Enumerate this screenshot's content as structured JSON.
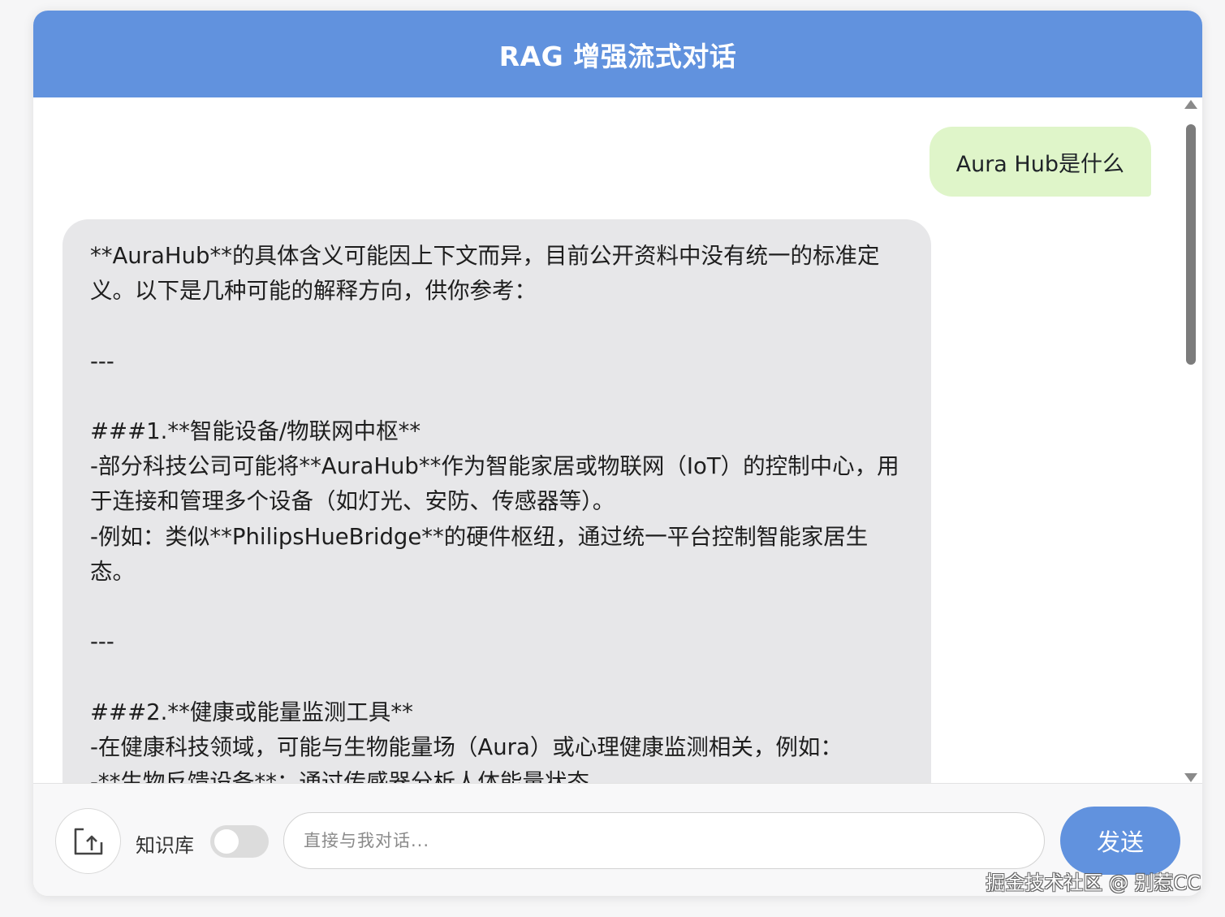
{
  "header": {
    "title": "RAG 增强流式对话"
  },
  "messages": {
    "user": "Aura Hub是什么",
    "assistant": "**AuraHub**的具体含义可能因上下文而异，目前公开资料中没有统一的标准定义。以下是几种可能的解释方向，供你参考：\n\n---\n\n###1.**智能设备/物联网中枢**\n-部分科技公司可能将**AuraHub**作为智能家居或物联网（IoT）的控制中心，用于连接和管理多个设备（如灯光、安防、传感器等）。\n-例如：类似**PhilipsHueBridge**的硬件枢纽，通过统一平台控制智能家居生态。\n\n---\n\n###2.**健康或能量监测工具**\n-在健康科技领域，可能与生物能量场（Aura）或心理健康监测相关，例如：\n-**生物反馈设备**：通过传感器分析人体能量状态"
  },
  "footer": {
    "upload_icon": "upload-file-icon",
    "knowledge_base_label": "知识库",
    "knowledge_base_enabled": false,
    "input_placeholder": "直接与我对话...",
    "input_value": "",
    "send_label": "发送"
  },
  "watermark": "掘金技术社区 @ 别惹CC",
  "colors": {
    "accent": "#6192de",
    "user_bubble": "#dff5c9",
    "assistant_bubble": "#e7e7e9"
  }
}
